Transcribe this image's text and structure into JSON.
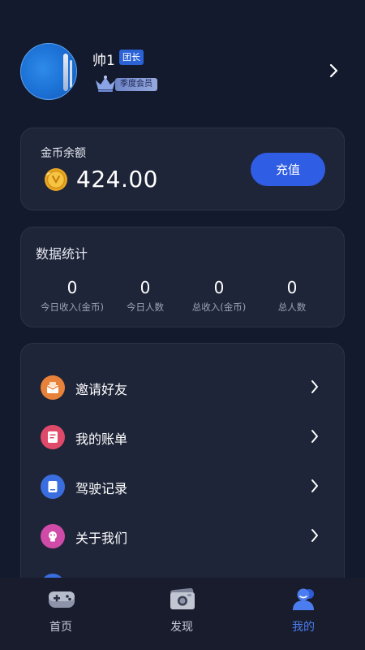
{
  "profile": {
    "name": "帅1",
    "role_badge": "团长",
    "member_badge": "季度会员"
  },
  "balance": {
    "label": "金币余额",
    "value": "424.00",
    "recharge_label": "充值"
  },
  "stats": {
    "title": "数据统计",
    "items": [
      {
        "value": "0",
        "label": "今日收入(金币)"
      },
      {
        "value": "0",
        "label": "今日人数"
      },
      {
        "value": "0",
        "label": "总收入(金币)"
      },
      {
        "value": "0",
        "label": "总人数"
      }
    ]
  },
  "menu": {
    "items": [
      {
        "label": "邀请好友",
        "icon": "invite-envelope-icon",
        "color": "#e8823a"
      },
      {
        "label": "我的账单",
        "icon": "bill-icon",
        "color": "#e04a6a"
      },
      {
        "label": "驾驶记录",
        "icon": "driving-record-icon",
        "color": "#3a6de0"
      },
      {
        "label": "关于我们",
        "icon": "about-us-icon",
        "color": "#d04aa8"
      }
    ]
  },
  "tabbar": {
    "items": [
      {
        "label": "首页",
        "icon": "gamepad-icon",
        "active": false
      },
      {
        "label": "发现",
        "icon": "camera-icon",
        "active": false
      },
      {
        "label": "我的",
        "icon": "user-icon",
        "active": true
      }
    ]
  },
  "colors": {
    "background": "#141a2e",
    "card": "#1f2538",
    "accent": "#2f5de3",
    "active_tab": "#4c7df0"
  }
}
